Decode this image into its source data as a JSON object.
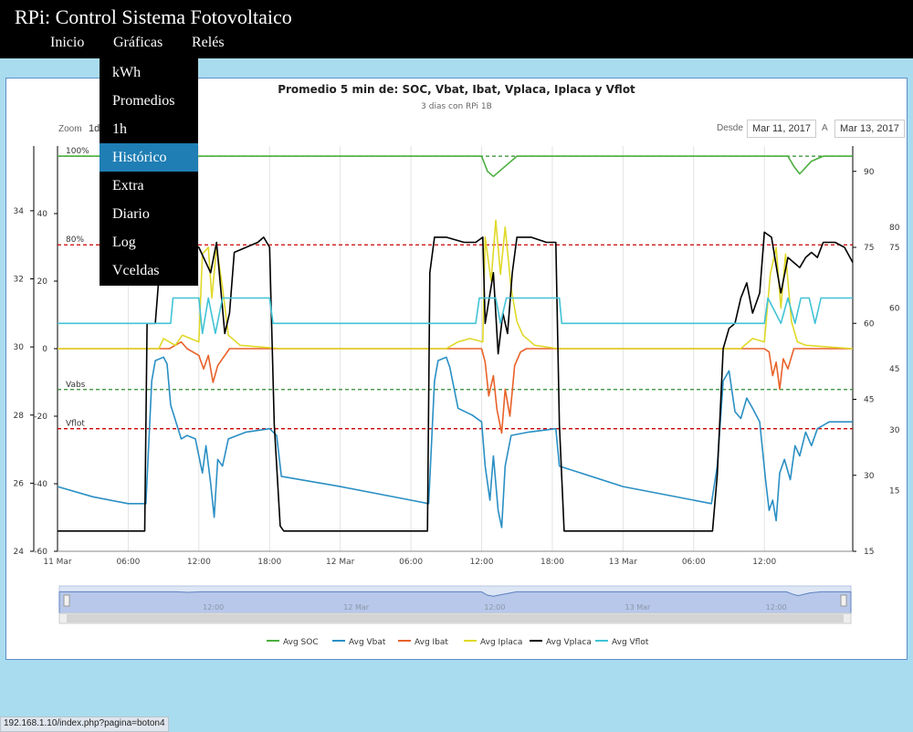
{
  "app": {
    "title": "RPi: Control Sistema Fotovoltaico"
  },
  "nav": {
    "items": [
      {
        "label": "Inicio"
      },
      {
        "label": "Gráficas"
      },
      {
        "label": "Relés"
      }
    ]
  },
  "dropdown": {
    "items": [
      {
        "label": "kWh"
      },
      {
        "label": "Promedios"
      },
      {
        "label": "1h"
      },
      {
        "label": "Histórico",
        "active": true
      },
      {
        "label": "Extra"
      },
      {
        "label": "Diario"
      },
      {
        "label": "Log"
      },
      {
        "label": "Vceldas"
      }
    ]
  },
  "controls": {
    "zoom_label": "Zoom",
    "zoom_value": "1d",
    "from_label": "Desde",
    "from_date": "Mar 11, 2017",
    "to_label": "A",
    "to_date": "Mar 13, 2017"
  },
  "statusbar": {
    "url": "192.168.1.10/index.php?pagina=boton4"
  },
  "chart_data": {
    "type": "line",
    "title": "Promedio 5 min de: SOC, Vbat, Ibat, Vplaca, Iplaca y Vflot",
    "subtitle": "3 dias con RPi 1B",
    "x_range": [
      0,
      67.5
    ],
    "x_unit": "hours from 11 Mar 00:00",
    "x_ticks": [
      {
        "x": 0,
        "label": "11 Mar"
      },
      {
        "x": 6,
        "label": "06:00"
      },
      {
        "x": 12,
        "label": "12:00"
      },
      {
        "x": 18,
        "label": "18:00"
      },
      {
        "x": 24,
        "label": "12 Mar"
      },
      {
        "x": 30,
        "label": "06:00"
      },
      {
        "x": 36,
        "label": "12:00"
      },
      {
        "x": 42,
        "label": "18:00"
      },
      {
        "x": 48,
        "label": "13 Mar"
      },
      {
        "x": 54,
        "label": "06:00"
      },
      {
        "x": 60,
        "label": "12:00"
      }
    ],
    "axes": {
      "left_outer": {
        "range": [
          24,
          35.9
        ],
        "ticks": [
          24,
          26,
          28,
          30,
          32,
          34
        ]
      },
      "left_inner": {
        "range": [
          -60,
          60
        ],
        "ticks": [
          -60,
          -40,
          -20,
          0,
          20,
          40
        ]
      },
      "right_inner": {
        "range": [
          15,
          95
        ],
        "ticks": [
          15,
          30,
          45,
          60,
          75,
          90
        ]
      },
      "right_outer": {
        "range": [
          0,
          100
        ],
        "ticks": [
          15,
          30,
          45,
          60,
          75,
          80
        ]
      }
    },
    "plot_lines": [
      {
        "label": "100%",
        "axis": "right_inner",
        "value": 93,
        "color": "#2e8b2e"
      },
      {
        "label": "80%",
        "axis": "right_inner",
        "value": 75.5,
        "color": "#cc0000"
      },
      {
        "label": "Vabs",
        "axis": "left_outer",
        "value": 28.75,
        "color": "#2e8b2e"
      },
      {
        "label": "Vflot",
        "axis": "left_outer",
        "value": 27.6,
        "color": "#cc0000"
      }
    ],
    "series": [
      {
        "name": "Avg SOC",
        "color": "#4caf3f",
        "axis": "right_inner",
        "points": [
          [
            0,
            93
          ],
          [
            10,
            93
          ],
          [
            11,
            92.5
          ],
          [
            12,
            93
          ],
          [
            36,
            93
          ],
          [
            36.5,
            90
          ],
          [
            37,
            89
          ],
          [
            38,
            91
          ],
          [
            39,
            93
          ],
          [
            58,
            93
          ],
          [
            62,
            93
          ],
          [
            62.5,
            91
          ],
          [
            63,
            89.5
          ],
          [
            64,
            92
          ],
          [
            65,
            93
          ],
          [
            67.5,
            93
          ]
        ]
      },
      {
        "name": "Avg Vbat",
        "color": "#2a8fc4",
        "axis": "left_outer",
        "points": [
          [
            0,
            25.9
          ],
          [
            3,
            25.6
          ],
          [
            6,
            25.4
          ],
          [
            7.5,
            25.4
          ],
          [
            8,
            29
          ],
          [
            8.3,
            29.6
          ],
          [
            9,
            29.7
          ],
          [
            9.3,
            29.5
          ],
          [
            9.6,
            28.3
          ],
          [
            10.5,
            27.3
          ],
          [
            11,
            27.4
          ],
          [
            11.7,
            27.3
          ],
          [
            12,
            26.8
          ],
          [
            12.3,
            26.3
          ],
          [
            12.6,
            27.1
          ],
          [
            13,
            26
          ],
          [
            13.3,
            25
          ],
          [
            13.6,
            26.7
          ],
          [
            14,
            26.5
          ],
          [
            14.5,
            27.3
          ],
          [
            16,
            27.5
          ],
          [
            18,
            27.6
          ],
          [
            18.6,
            27.4
          ],
          [
            19,
            26.2
          ],
          [
            24,
            25.9
          ],
          [
            30,
            25.5
          ],
          [
            31.5,
            25.4
          ],
          [
            32,
            29
          ],
          [
            32.3,
            29.6
          ],
          [
            33,
            29.7
          ],
          [
            33.3,
            29.4
          ],
          [
            34,
            28.2
          ],
          [
            35.2,
            28
          ],
          [
            36,
            27.8
          ],
          [
            36.3,
            26.5
          ],
          [
            36.7,
            25.5
          ],
          [
            37,
            26.8
          ],
          [
            37.4,
            25.2
          ],
          [
            37.7,
            24.7
          ],
          [
            38,
            26.5
          ],
          [
            38.5,
            27.4
          ],
          [
            40,
            27.5
          ],
          [
            42.3,
            27.6
          ],
          [
            42.6,
            26.5
          ],
          [
            48,
            25.9
          ],
          [
            54,
            25.5
          ],
          [
            55.5,
            25.4
          ],
          [
            56,
            26.5
          ],
          [
            56.5,
            29
          ],
          [
            57,
            29.3
          ],
          [
            57.5,
            28.1
          ],
          [
            58,
            27.9
          ],
          [
            58.5,
            28.5
          ],
          [
            59,
            28.2
          ],
          [
            59.6,
            27.8
          ],
          [
            60.1,
            26.1
          ],
          [
            60.4,
            25.2
          ],
          [
            60.7,
            25.5
          ],
          [
            61,
            24.9
          ],
          [
            61.3,
            26.3
          ],
          [
            61.7,
            26.7
          ],
          [
            62.2,
            26.1
          ],
          [
            62.6,
            27.1
          ],
          [
            63,
            26.8
          ],
          [
            63.5,
            27.5
          ],
          [
            64,
            27.1
          ],
          [
            64.5,
            27.6
          ],
          [
            65.5,
            27.8
          ],
          [
            66.5,
            27.8
          ],
          [
            67.5,
            27.8
          ]
        ]
      },
      {
        "name": "Avg Ibat",
        "color": "#e8622a",
        "axis": "left_inner",
        "points": [
          [
            0,
            0
          ],
          [
            9.5,
            0
          ],
          [
            10,
            1
          ],
          [
            10.5,
            2
          ],
          [
            11,
            0
          ],
          [
            12,
            -2
          ],
          [
            12.4,
            -6
          ],
          [
            12.8,
            -2
          ],
          [
            13.2,
            -10
          ],
          [
            13.6,
            -5
          ],
          [
            14,
            -3
          ],
          [
            14.6,
            0
          ],
          [
            36,
            0
          ],
          [
            36.3,
            -4
          ],
          [
            36.6,
            -14
          ],
          [
            37,
            -8
          ],
          [
            37.3,
            -18
          ],
          [
            37.7,
            -25
          ],
          [
            38,
            -12
          ],
          [
            38.4,
            -20
          ],
          [
            38.8,
            -5
          ],
          [
            39.3,
            -1
          ],
          [
            39.8,
            0
          ],
          [
            60,
            0
          ],
          [
            60.4,
            -1
          ],
          [
            60.7,
            -8
          ],
          [
            61,
            -4
          ],
          [
            61.3,
            -12
          ],
          [
            61.6,
            -3
          ],
          [
            62,
            -6
          ],
          [
            62.5,
            0
          ],
          [
            67.5,
            0
          ]
        ]
      },
      {
        "name": "Avg Iplaca",
        "color": "#e0d928",
        "axis": "left_inner",
        "points": [
          [
            0,
            0
          ],
          [
            8.6,
            0
          ],
          [
            9,
            3
          ],
          [
            10,
            1
          ],
          [
            10.6,
            4
          ],
          [
            12,
            2
          ],
          [
            12.3,
            28
          ],
          [
            12.8,
            30
          ],
          [
            13.1,
            15
          ],
          [
            13.5,
            30
          ],
          [
            14,
            18
          ],
          [
            14.5,
            4
          ],
          [
            15.5,
            1
          ],
          [
            19,
            0
          ],
          [
            33,
            0
          ],
          [
            34,
            2
          ],
          [
            35,
            3
          ],
          [
            36.1,
            2
          ],
          [
            36.3,
            33
          ],
          [
            36.8,
            20
          ],
          [
            37.2,
            38
          ],
          [
            37.6,
            22
          ],
          [
            38,
            36
          ],
          [
            38.5,
            18
          ],
          [
            39,
            8
          ],
          [
            39.5,
            4
          ],
          [
            40.5,
            1
          ],
          [
            42.5,
            0
          ],
          [
            58,
            0
          ],
          [
            59,
            3
          ],
          [
            60,
            2
          ],
          [
            60.5,
            22
          ],
          [
            61,
            30
          ],
          [
            61.4,
            12
          ],
          [
            61.8,
            28
          ],
          [
            62.3,
            8
          ],
          [
            62.8,
            2
          ],
          [
            63.5,
            1
          ],
          [
            67.5,
            0
          ]
        ]
      },
      {
        "name": "Avg Vplaca",
        "color": "#000000",
        "axis": "right_inner",
        "points": [
          [
            0,
            19
          ],
          [
            4,
            19
          ],
          [
            7.4,
            19
          ],
          [
            7.6,
            60
          ],
          [
            8.3,
            60
          ],
          [
            8.7,
            72
          ],
          [
            9.5,
            74
          ],
          [
            10,
            75
          ],
          [
            11,
            76
          ],
          [
            12,
            75
          ],
          [
            13,
            70
          ],
          [
            13.5,
            76
          ],
          [
            14.2,
            58
          ],
          [
            14.6,
            62
          ],
          [
            15,
            74
          ],
          [
            16,
            75
          ],
          [
            17,
            76
          ],
          [
            17.5,
            77
          ],
          [
            18,
            75
          ],
          [
            18.4,
            40
          ],
          [
            18.9,
            20
          ],
          [
            19.2,
            19
          ],
          [
            31.4,
            19
          ],
          [
            31.6,
            70
          ],
          [
            32,
            77
          ],
          [
            33,
            77
          ],
          [
            34.5,
            76
          ],
          [
            35.5,
            76
          ],
          [
            36.1,
            77
          ],
          [
            36.3,
            60
          ],
          [
            37,
            70
          ],
          [
            37.4,
            54
          ],
          [
            37.8,
            62
          ],
          [
            38.2,
            58
          ],
          [
            38.6,
            70
          ],
          [
            39,
            77
          ],
          [
            40.2,
            77
          ],
          [
            41.5,
            76
          ],
          [
            42.3,
            76
          ],
          [
            42.6,
            40
          ],
          [
            43,
            19
          ],
          [
            55.6,
            19
          ],
          [
            56,
            30
          ],
          [
            56.5,
            55
          ],
          [
            57,
            59
          ],
          [
            57.5,
            60
          ],
          [
            58,
            65
          ],
          [
            58.5,
            68
          ],
          [
            59,
            62
          ],
          [
            59.6,
            66
          ],
          [
            60,
            78
          ],
          [
            60.6,
            77
          ],
          [
            61.1,
            70
          ],
          [
            61.4,
            66
          ],
          [
            62,
            73
          ],
          [
            62.5,
            72
          ],
          [
            63,
            71
          ],
          [
            63.5,
            73
          ],
          [
            64,
            74
          ],
          [
            64.5,
            73
          ],
          [
            65,
            76
          ],
          [
            66,
            76
          ],
          [
            66.8,
            75
          ],
          [
            67.5,
            72
          ]
        ]
      },
      {
        "name": "Avg Vflot",
        "color": "#41c3d6",
        "axis": "right_inner",
        "points": [
          [
            0,
            60
          ],
          [
            9.6,
            60
          ],
          [
            9.8,
            65
          ],
          [
            12,
            65
          ],
          [
            12.3,
            58
          ],
          [
            12.8,
            65
          ],
          [
            13.4,
            58
          ],
          [
            14,
            65
          ],
          [
            16,
            65
          ],
          [
            18,
            65
          ],
          [
            18.3,
            60
          ],
          [
            35.5,
            60
          ],
          [
            35.8,
            65
          ],
          [
            37.2,
            65
          ],
          [
            37.6,
            60
          ],
          [
            38.1,
            65
          ],
          [
            40.5,
            65
          ],
          [
            42.6,
            65
          ],
          [
            42.8,
            60
          ],
          [
            60,
            60
          ],
          [
            60.3,
            65
          ],
          [
            61.4,
            60
          ],
          [
            62,
            65
          ],
          [
            62.6,
            60
          ],
          [
            63.1,
            65
          ],
          [
            63.8,
            65
          ],
          [
            64.3,
            60
          ],
          [
            64.8,
            65
          ],
          [
            67.5,
            65
          ]
        ]
      }
    ],
    "legend_position": "bottom"
  }
}
